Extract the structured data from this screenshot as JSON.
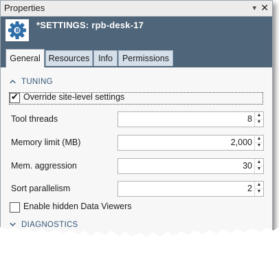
{
  "window": {
    "title": "Properties",
    "pin_glyph": "▾",
    "close_glyph": "✕"
  },
  "header": {
    "title": "*SETTINGS: rpb-desk-17",
    "icon": "settings-document-icon",
    "bg_color": "#4f6579"
  },
  "tabs": [
    {
      "label": "General",
      "active": true
    },
    {
      "label": "Resources",
      "active": false
    },
    {
      "label": "Info",
      "active": false
    },
    {
      "label": "Permissions",
      "active": false
    }
  ],
  "sections": {
    "tuning": {
      "label": "TUNING",
      "expanded": true
    },
    "diagnostics": {
      "label": "DIAGNOSTICS",
      "expanded": false
    }
  },
  "override": {
    "label": "Override site-level settings",
    "checked": true
  },
  "properties": [
    {
      "label": "Tool threads",
      "value": "8"
    },
    {
      "label": "Memory limit (MB)",
      "value": "2,000"
    },
    {
      "label": "Mem. aggression",
      "value": "30"
    },
    {
      "label": "Sort parallelism",
      "value": "2"
    }
  ],
  "hidden_viewers": {
    "label": "Enable hidden Data Viewers",
    "checked": false
  }
}
